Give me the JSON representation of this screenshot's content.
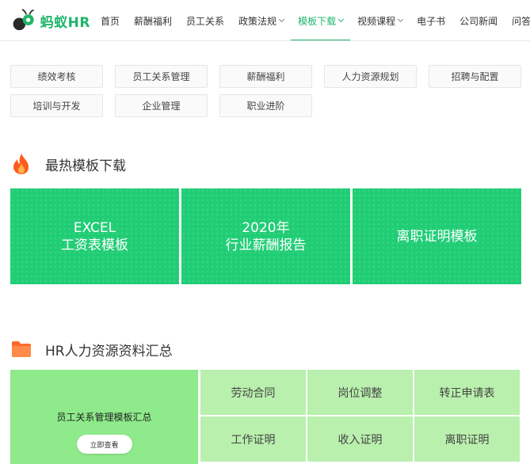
{
  "brand": {
    "logo_text": "蚂蚁HR",
    "accent_color": "#1fb56a"
  },
  "nav": {
    "items": [
      {
        "label": "首页",
        "dropdown": false,
        "active": false
      },
      {
        "label": "薪酬福利",
        "dropdown": false,
        "active": false
      },
      {
        "label": "员工关系",
        "dropdown": false,
        "active": false
      },
      {
        "label": "政策法规",
        "dropdown": true,
        "active": false
      },
      {
        "label": "模板下载",
        "dropdown": true,
        "active": true
      },
      {
        "label": "视频课程",
        "dropdown": true,
        "active": false
      },
      {
        "label": "电子书",
        "dropdown": false,
        "active": false
      },
      {
        "label": "公司新闻",
        "dropdown": false,
        "active": false
      },
      {
        "label": "问答",
        "dropdown": false,
        "active": false
      }
    ]
  },
  "categories": [
    "绩效考核",
    "员工关系管理",
    "薪酬福利",
    "人力资源规划",
    "招聘与配置",
    "培训与开发",
    "企业管理",
    "职业进阶"
  ],
  "hot": {
    "title": "最热模板下载",
    "banners": [
      {
        "line1": "EXCEL",
        "line2": "工资表模板"
      },
      {
        "line1": "2020年",
        "line2": "行业薪酬报告"
      },
      {
        "line1": "离职证明模板",
        "line2": ""
      }
    ],
    "banner_color": "#20cd75"
  },
  "hr": {
    "title": "HR人力资源资料汇总",
    "feature_label": "员工关系管理模板汇总",
    "feature_button": "立即查看",
    "items": [
      "劳动合同",
      "岗位调整",
      "转正申请表",
      "工作证明",
      "收入证明",
      "离职证明"
    ]
  }
}
